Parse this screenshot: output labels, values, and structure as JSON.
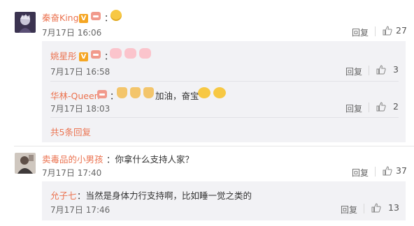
{
  "comments": [
    {
      "user": "秦奋King",
      "text": "：",
      "time": "7月17日 16:06",
      "reply": "回复",
      "likes": "27",
      "replies": [
        {
          "user": "姚星彤",
          "text": "：",
          "time": "7月17日 16:58",
          "reply": "回复",
          "likes": "3"
        },
        {
          "user": "华林-Queen",
          "text_pre": "：",
          "text_mid": "加油，奋宝",
          "time": "7月17日 18:03",
          "reply": "回复",
          "likes": "2"
        }
      ],
      "more_replies": "共5条回复"
    },
    {
      "user": "卖毒品的小男孩",
      "text": "：你拿什么支持人家？",
      "time": "7月17日 17:40",
      "reply": "回复",
      "likes": "37",
      "replies": [
        {
          "user": "允子七",
          "text": "：当然是身体力行支持啊，比如睡一觉之类的",
          "time": "7月17日 17:46",
          "reply": "回复",
          "likes": "13"
        }
      ]
    }
  ],
  "icons": {
    "like": "thumbs-up-icon",
    "verified": "v-badge-icon",
    "vip": "vip-crown-icon"
  },
  "colors": {
    "username": "#eb7350",
    "panel": "#f2f2f5",
    "text": "#333333",
    "muted": "#666666"
  }
}
